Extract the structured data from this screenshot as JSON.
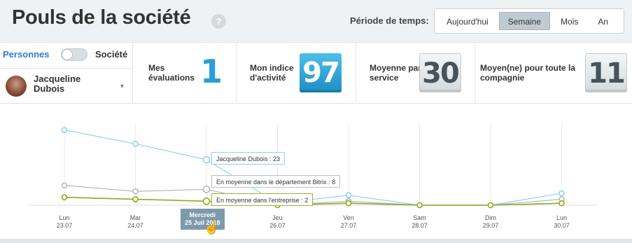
{
  "header": {
    "title": "Pouls de la société",
    "help": "?",
    "period_label": "Période de temps:",
    "periods": [
      "Aujourd'hui",
      "Semaine",
      "Mois",
      "An"
    ],
    "active_period": "Semaine"
  },
  "toggle": {
    "left": "Personnes",
    "right": "Société"
  },
  "user": {
    "name": "Jacqueline Dubois"
  },
  "stats": [
    {
      "label": "Mes évaluations",
      "value": "1"
    },
    {
      "label": "Mon indice d'activité",
      "value": "97"
    },
    {
      "label": "Moyenne par service",
      "value": "30"
    },
    {
      "label": "Moyen(ne) pour toute la compagnie",
      "value": "11"
    }
  ],
  "colors": {
    "blue": "#8fd3ee",
    "grey": "#b3b8bd",
    "green": "#8dac1a",
    "accent": "#2a9fd6"
  },
  "chart_data": {
    "type": "line",
    "categories": [
      "Lun 23.07",
      "Mar 24.07",
      "Mercredi 25 Juil 2018",
      "Jeu 26.07",
      "Ven 27.07",
      "Sam 28.07",
      "Dim 29.07",
      "Lun 30.07"
    ],
    "x_labels_top": [
      "Lun",
      "Mar",
      "Mercredi",
      "Jeu",
      "Ven",
      "Sam",
      "Dim",
      "Lun"
    ],
    "x_labels_bottom": [
      "23.07",
      "24.07",
      "25 Juil 2018",
      "26.07",
      "27.07",
      "28.07",
      "29.07",
      "30.07"
    ],
    "active_index": 2,
    "series": [
      {
        "name": "Jacqueline Dubois",
        "values": [
          38,
          31,
          23,
          1,
          5,
          0,
          0,
          6
        ]
      },
      {
        "name": "En moyenne dans le département Bitrix",
        "values": [
          10,
          7,
          8,
          0,
          2,
          0,
          0,
          3
        ]
      },
      {
        "name": "En moyenne dans l'entreprise",
        "values": [
          4,
          3,
          2,
          0,
          1,
          0,
          0,
          1
        ]
      }
    ],
    "tooltips": [
      "Jacqueline Dubois : 23",
      "En moyenne dans le département Bitrix : 8",
      "En moyenne dans l'entreprise : 2"
    ],
    "ylim": [
      0,
      40
    ],
    "grid": true
  }
}
